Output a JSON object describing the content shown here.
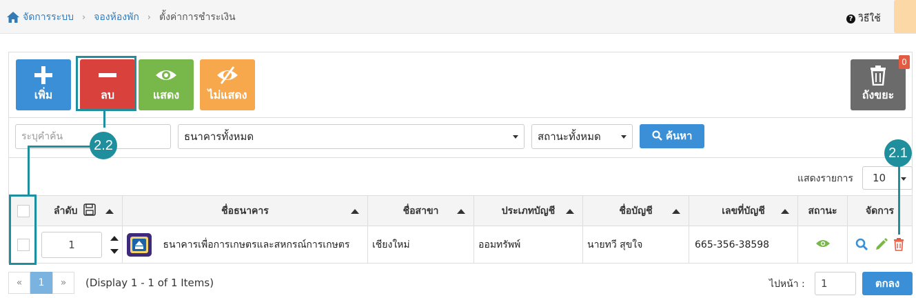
{
  "breadcrumb": {
    "items": [
      "จัดการระบบ",
      "จองห้องพัก"
    ],
    "current": "ตั้งค่าการชำระเงิน"
  },
  "help": {
    "label": "วิธีใช้",
    "glyph": "?"
  },
  "toolbar": {
    "add": "เพิ่ม",
    "delete": "ลบ",
    "show": "แสดง",
    "hide": "ไม่แสดง",
    "trash": "ถังขยะ",
    "trash_count": "0"
  },
  "filters": {
    "search_placeholder": "ระบุคำค้น",
    "bank": "ธนาคารทั้งหมด",
    "status": "สถานะทั้งหมด",
    "search_btn": "ค้นหา"
  },
  "callouts": {
    "delete_callout": "2.2",
    "trash_callout": "2.1"
  },
  "page_size": {
    "label": "แสดงรายการ",
    "value": "10"
  },
  "table": {
    "headers": [
      "ลำดับ",
      "ชื่อธนาคาร",
      "ชื่อสาขา",
      "ประเภทบัญชี",
      "ชื่อบัญชี",
      "เลขที่บัญชี",
      "สถานะ",
      "จัดการ"
    ],
    "rows": [
      {
        "order": "1",
        "bank": "ธนาคารเพื่อการเกษตรและสหกรณ์การเกษตร",
        "branch": "เชียงใหม่",
        "type": "ออมทรัพพ์",
        "account_name": "นายทวี สุขใจ",
        "account_no": "665-356-38598"
      }
    ]
  },
  "pager": {
    "prev": "«",
    "page": "1",
    "next": "»",
    "display": "(Display 1 - 1 of 1 Items)",
    "goto_label": "ไปหน้า :",
    "goto_value": "1",
    "go_btn": "ตกลง"
  },
  "colors": {
    "primary": "#3a8fd6",
    "danger": "#d9413c",
    "success": "#78b84b",
    "warning": "#f7a84c",
    "teal": "#1f8f9d"
  }
}
